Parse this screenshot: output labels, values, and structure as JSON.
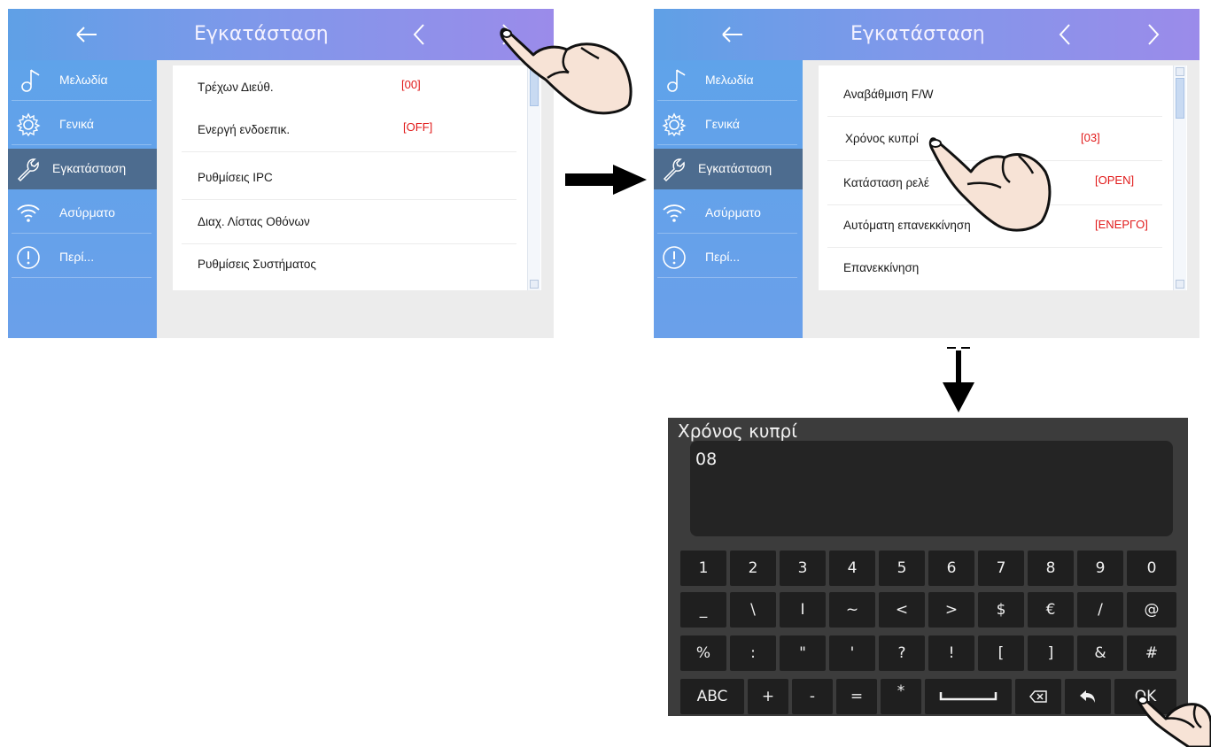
{
  "screen1": {
    "title": "Εγκατάσταση",
    "sidebar": [
      {
        "label": "Μελωδία",
        "icon": "music-note-icon",
        "active": false
      },
      {
        "label": "Γενικά",
        "icon": "gear-icon",
        "active": false
      },
      {
        "label": "Εγκατάσταση",
        "icon": "wrench-icon",
        "active": true
      },
      {
        "label": "Ασύρματο",
        "icon": "wifi-icon",
        "active": false
      },
      {
        "label": "Περί...",
        "icon": "info-icon",
        "active": false
      }
    ],
    "rows": [
      {
        "label": "Τρέχων Διεύθ.",
        "value": "[00]"
      },
      {
        "label": "Ενεργή ενδοεπικ.",
        "value": "[OFF]"
      },
      {
        "label": "Ρυθμίσεις IPC",
        "value": ""
      },
      {
        "label": "Διαχ. Λίστας Οθόνων",
        "value": ""
      },
      {
        "label": "Ρυθμίσεις Συστήματος",
        "value": ""
      }
    ]
  },
  "screen2": {
    "title": "Εγκατάσταση",
    "sidebar": [
      {
        "label": "Μελωδία",
        "icon": "music-note-icon",
        "active": false
      },
      {
        "label": "Γενικά",
        "icon": "gear-icon",
        "active": false
      },
      {
        "label": "Εγκατάσταση",
        "icon": "wrench-icon",
        "active": true
      },
      {
        "label": "Ασύρματο",
        "icon": "wifi-icon",
        "active": false
      },
      {
        "label": "Περί...",
        "icon": "info-icon",
        "active": false
      }
    ],
    "rows": [
      {
        "label": "Αναβάθμιση F/W",
        "value": ""
      },
      {
        "label": "Χρόνος κυπρί",
        "value": "[03]"
      },
      {
        "label": "Κατάσταση ρελέ",
        "value": "[OPEN]"
      },
      {
        "label": "Αυτόματη επανεκκίνηση",
        "value": "[ΕΝΕΡΓΟ]"
      },
      {
        "label": "Επανεκκίνηση",
        "value": ""
      }
    ]
  },
  "keyboard": {
    "title": "Χρόνος κυπρί",
    "input_value": "08",
    "row1": [
      "1",
      "2",
      "3",
      "4",
      "5",
      "6",
      "7",
      "8",
      "9",
      "0"
    ],
    "row2": [
      "_",
      "\\",
      "I",
      "~",
      "<",
      ">",
      "$",
      "€",
      "/",
      "@"
    ],
    "row3": [
      "%",
      ":",
      "\"",
      "'",
      "?",
      "!",
      "[",
      "]",
      "&",
      "#"
    ],
    "row4": [
      "ABC",
      "+",
      "-",
      "=",
      "*"
    ],
    "ok_label": "OK"
  },
  "colors": {
    "value_red": "#e11a1a",
    "sidebar_blue": "#5fa3ea",
    "active_item": "#4d6c8f"
  }
}
